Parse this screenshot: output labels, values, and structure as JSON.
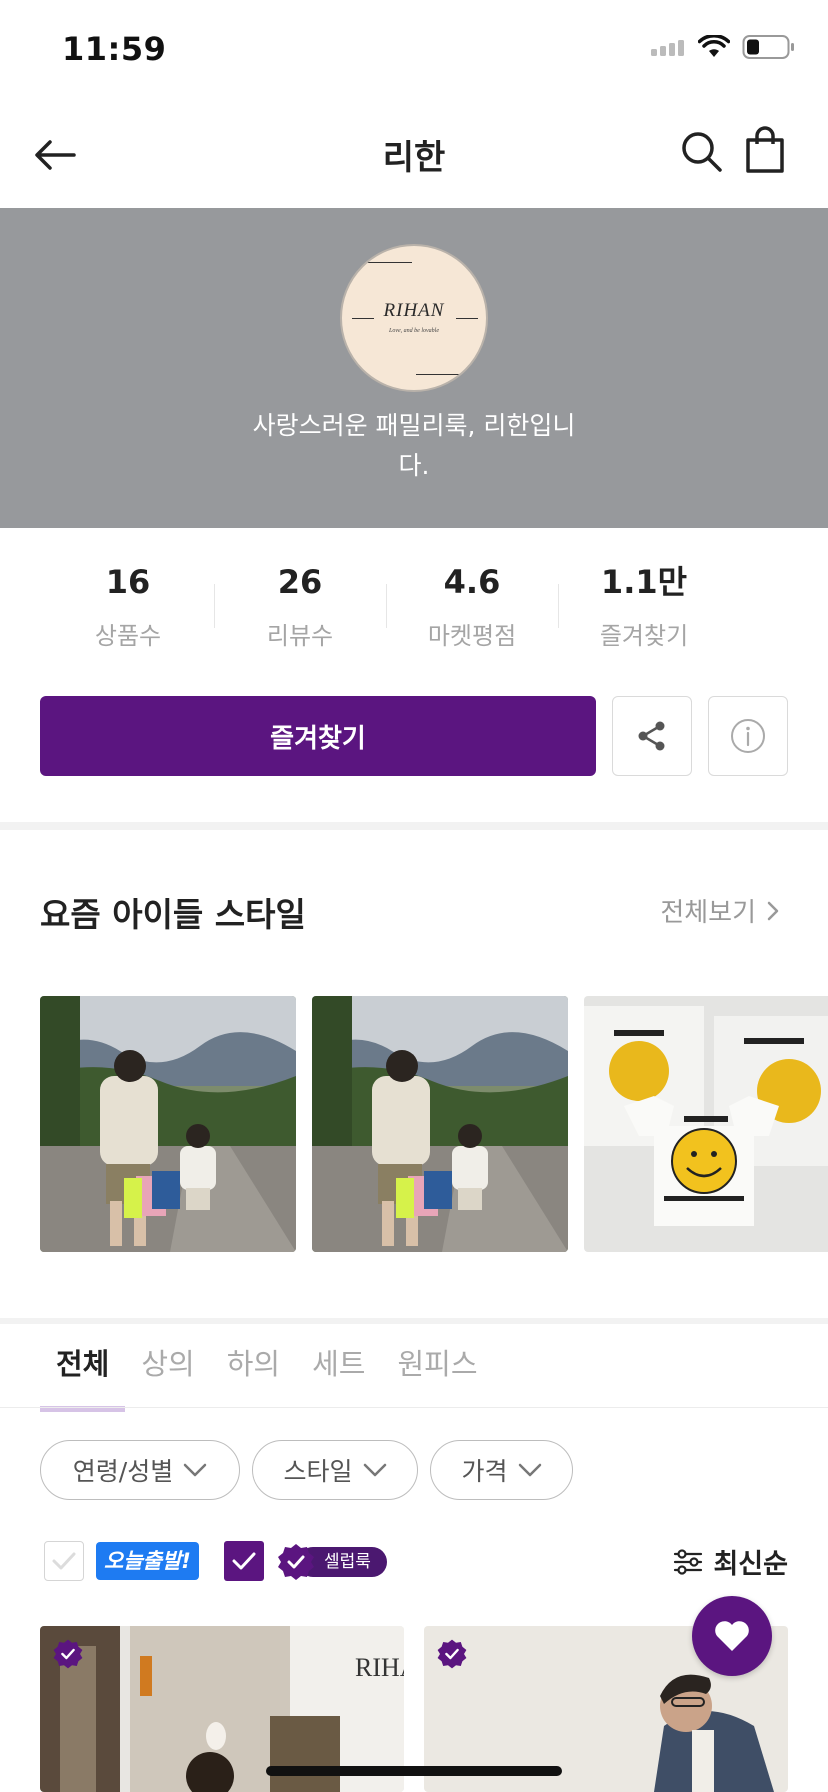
{
  "status_bar": {
    "time": "11:59"
  },
  "nav": {
    "title": "리한"
  },
  "store": {
    "logo_text": "RIHAN",
    "logo_sub": "Love, and be lovable",
    "description": "사랑스러운 패밀리룩, 리한입니다."
  },
  "stats": [
    {
      "value": "16",
      "label": "상품수"
    },
    {
      "value": "26",
      "label": "리뷰수"
    },
    {
      "value": "4.6",
      "label": "마켓평점"
    },
    {
      "value": "1.1만",
      "label": "즐겨찾기"
    }
  ],
  "actions": {
    "favorite_label": "즐겨찾기"
  },
  "style_section": {
    "title": "요즘 아이들 스타일",
    "see_all": "전체보기"
  },
  "tabs": [
    {
      "label": "전체",
      "active": true
    },
    {
      "label": "상의",
      "active": false
    },
    {
      "label": "하의",
      "active": false
    },
    {
      "label": "세트",
      "active": false
    },
    {
      "label": "원피스",
      "active": false
    }
  ],
  "filters": [
    {
      "label": "연령/성별"
    },
    {
      "label": "스타일"
    },
    {
      "label": "가격"
    }
  ],
  "toggles": {
    "today_ship_label": "오늘출발!",
    "today_ship_checked": false,
    "celeb_label": "셀럽룩",
    "celeb_checked": true
  },
  "sort": {
    "label": "최신순"
  },
  "colors": {
    "accent": "#5b1580",
    "hero_bg": "#97999c",
    "today_badge": "#1e7bf2"
  },
  "product_cards": [
    {
      "image_text": "RIHAN"
    },
    {
      "image_text": ""
    }
  ]
}
